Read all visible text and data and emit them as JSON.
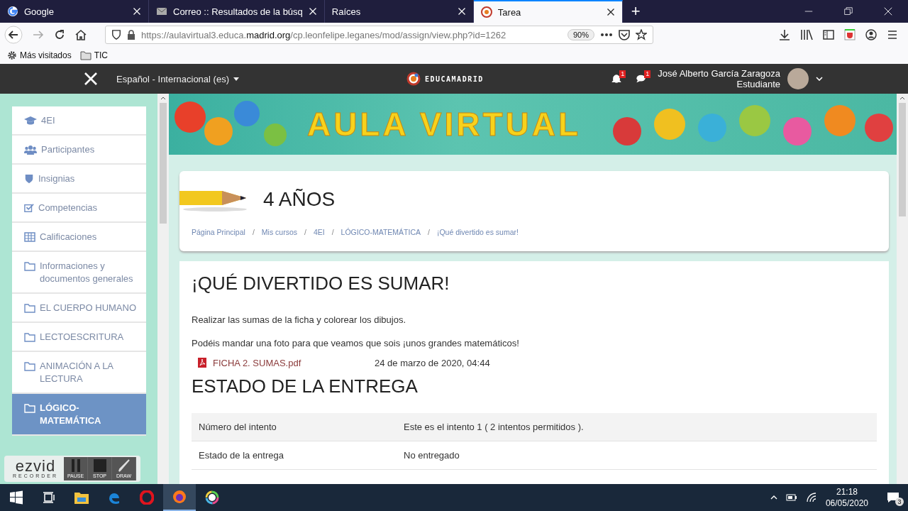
{
  "browser": {
    "tabs": [
      {
        "title": "Google",
        "kind": "google",
        "selected": false
      },
      {
        "title": "Correo :: Resultados de la búsq",
        "kind": "mail",
        "selected": false
      },
      {
        "title": "Raíces",
        "kind": "plain",
        "selected": false
      },
      {
        "title": "Tarea",
        "kind": "site",
        "selected": true
      }
    ],
    "new_tab": "+",
    "url": {
      "prefix": "https://aulavirtual3.educa.",
      "domain": "madrid.org",
      "path": "/cp.leonfelipe.leganes/mod/assign/view.php?id=1262"
    },
    "zoom": "90%",
    "bookmarks": [
      {
        "label": "Más visitados",
        "kind": "gear"
      },
      {
        "label": "TIC",
        "kind": "folder"
      }
    ]
  },
  "site_header": {
    "language": "Español - Internacional (es)",
    "logo": "EDUCAMADRID",
    "notifications_count": "1",
    "messages_count": "1",
    "user_name": "José Alberto García Zaragoza",
    "user_role": "Estudiante"
  },
  "sidebar": {
    "items": [
      {
        "label": "4EI",
        "kind": "cap",
        "selected": false
      },
      {
        "label": "Participantes",
        "kind": "users",
        "selected": false
      },
      {
        "label": "Insignias",
        "kind": "shield",
        "selected": false
      },
      {
        "label": "Competencias",
        "kind": "check",
        "selected": false
      },
      {
        "label": "Calificaciones",
        "kind": "grid",
        "selected": false
      },
      {
        "label": "Informaciones y documentos generales",
        "kind": "folder",
        "selected": false
      },
      {
        "label": "EL CUERPO HUMANO",
        "kind": "folder",
        "selected": false
      },
      {
        "label": "LECTOESCRITURA",
        "kind": "folder",
        "selected": false
      },
      {
        "label": "ANIMACIÓN A LA LECTURA",
        "kind": "folder",
        "selected": false
      },
      {
        "label": "LÓGICO-MATEMÁTICA",
        "kind": "folder",
        "selected": true
      }
    ]
  },
  "banner": {
    "title": "AULA VIRTUAL"
  },
  "course": {
    "title": "4 AÑOS",
    "breadcrumb": [
      {
        "label": "Página Principal",
        "separator": "/"
      },
      {
        "label": "Mis cursos",
        "separator": "/"
      },
      {
        "label": "4EI",
        "separator": "/"
      },
      {
        "label": "LÓGICO-MATEMÁTICA",
        "separator": "/"
      },
      {
        "label": "¡Qué divertido es sumar!"
      }
    ]
  },
  "assignment": {
    "title": "¡QUÉ DIVERTIDO ES SUMAR!",
    "paragraphs": [
      "Realizar las sumas de la ficha y colorear los dibujos.",
      "Podéis mandar una foto para que veamos que sois ¡unos grandes matemáticos!"
    ],
    "file": {
      "name": "FICHA 2. SUMAS.pdf",
      "date": "24 de marzo de 2020, 04:44"
    },
    "status_title": "ESTADO DE LA ENTREGA",
    "status_rows": [
      {
        "label": "Número del intento",
        "value": "Este es el intento 1 ( 2 intentos permitidos )."
      },
      {
        "label": "Estado de la entrega",
        "value": "No entregado"
      }
    ]
  },
  "recorder": {
    "logo": "ezvid",
    "subtitle": "RECORDER",
    "buttons": [
      {
        "label": "PAUSE",
        "kind": "pause"
      },
      {
        "label": "STOP",
        "kind": "stop"
      },
      {
        "label": "DRAW",
        "kind": "draw"
      }
    ]
  },
  "taskbar": {
    "apps": [
      {
        "kind": "start",
        "selected": false
      },
      {
        "kind": "taskview",
        "selected": false
      },
      {
        "kind": "explorer",
        "selected": false
      },
      {
        "kind": "edge",
        "selected": false
      },
      {
        "kind": "opera",
        "selected": false
      },
      {
        "kind": "firefox",
        "selected": true
      },
      {
        "kind": "colorwheel",
        "selected": false
      }
    ],
    "time": "21:18",
    "date": "06/05/2020",
    "notifications": "3"
  }
}
